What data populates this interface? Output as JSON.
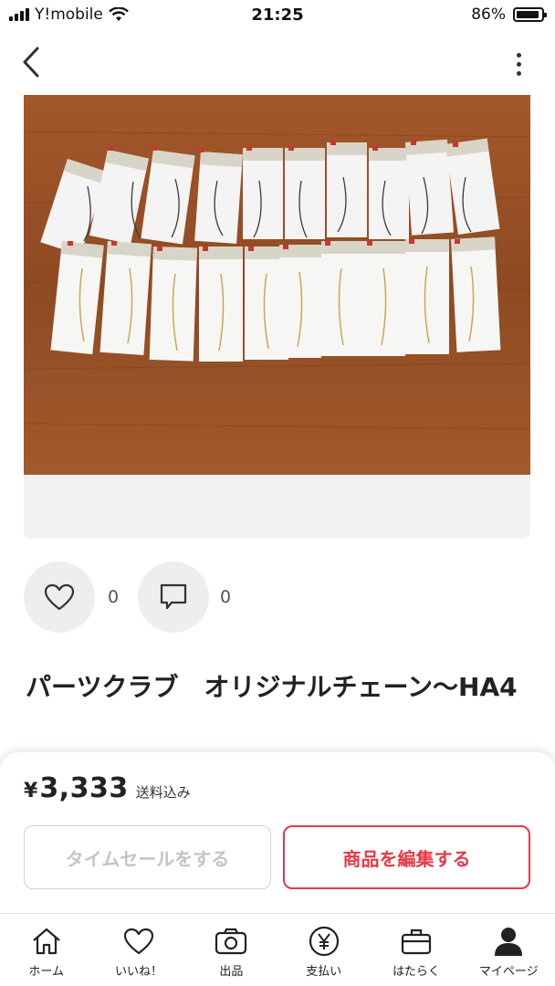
{
  "status_bar": {
    "carrier": "Y!mobile",
    "time": "21:25",
    "battery": "86%",
    "battery_level": 0.86,
    "icons": [
      "signal-icon",
      "wifi-icon",
      "battery-icon"
    ]
  },
  "nav": {
    "icons": [
      "back-icon",
      "more-vertical-icon"
    ]
  },
  "item": {
    "likes": "0",
    "comments": "0",
    "title": "パーツクラブ　オリジナルチェーン〜HA4",
    "photo_desc_icons": [
      "heart-icon",
      "comment-icon"
    ]
  },
  "purchase": {
    "currency": "¥",
    "price": "3,333",
    "shipping": "送料込み",
    "timesale_label": "タイムセールをする",
    "edit_label": "商品を編集する",
    "accent_color": "#e63946"
  },
  "tabs": [
    {
      "label": "ホーム",
      "icon": "home-icon"
    },
    {
      "label": "いいね！",
      "icon": "heart-icon"
    },
    {
      "label": "出品",
      "icon": "camera-icon"
    },
    {
      "label": "支払い",
      "icon": "yen-icon"
    },
    {
      "label": "はたらく",
      "icon": "briefcase-icon"
    },
    {
      "label": "マイページ",
      "icon": "person-icon"
    }
  ]
}
